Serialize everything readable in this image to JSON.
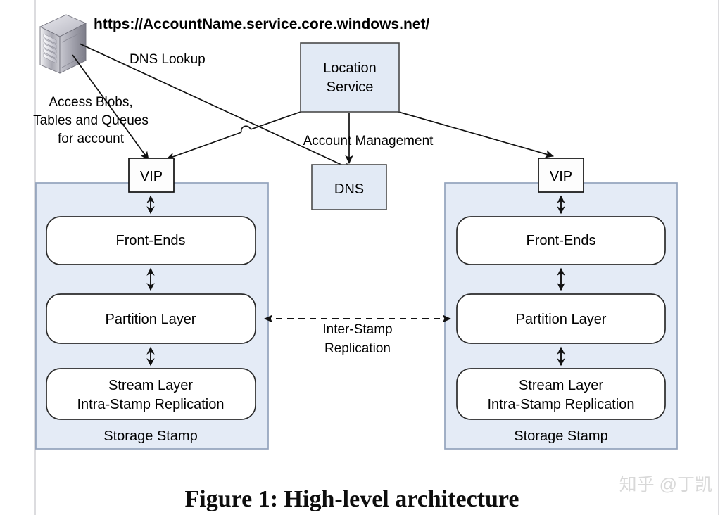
{
  "figure": {
    "caption": "Figure 1: High-level architecture",
    "watermark": "知乎 @丁凯"
  },
  "url_label": "https://AccountName.service.core.windows.net/",
  "annotations": {
    "dns_lookup": "DNS Lookup",
    "access_line1": "Access Blobs,",
    "access_line2": "Tables and Queues",
    "access_line3": "for account",
    "account_management": "Account Management",
    "inter_stamp_line1": "Inter-Stamp",
    "inter_stamp_line2": "Replication"
  },
  "nodes": {
    "client_icon": "server-tower-icon",
    "location_service": {
      "line1": "Location",
      "line2": "Service"
    },
    "dns": "DNS",
    "vip_left": "VIP",
    "vip_right": "VIP"
  },
  "stamps": [
    {
      "id": "left-stamp",
      "title": "Storage Stamp",
      "layers": [
        {
          "line1": "Front-Ends",
          "line2": ""
        },
        {
          "line1": "Partition Layer",
          "line2": ""
        },
        {
          "line1": "Stream Layer",
          "line2": "Intra-Stamp Replication"
        }
      ]
    },
    {
      "id": "right-stamp",
      "title": "Storage Stamp",
      "layers": [
        {
          "line1": "Front-Ends",
          "line2": ""
        },
        {
          "line1": "Partition Layer",
          "line2": ""
        },
        {
          "line1": "Stream Layer",
          "line2": "Intra-Stamp Replication"
        }
      ]
    }
  ],
  "colors": {
    "box_fill": "#e2eaf5",
    "stamp_fill": "#e4ebf6",
    "stroke": "#111111",
    "stamp_border": "#93a3bd",
    "inner_fill": "#ffffff",
    "watermark": "#d8d8d8"
  }
}
